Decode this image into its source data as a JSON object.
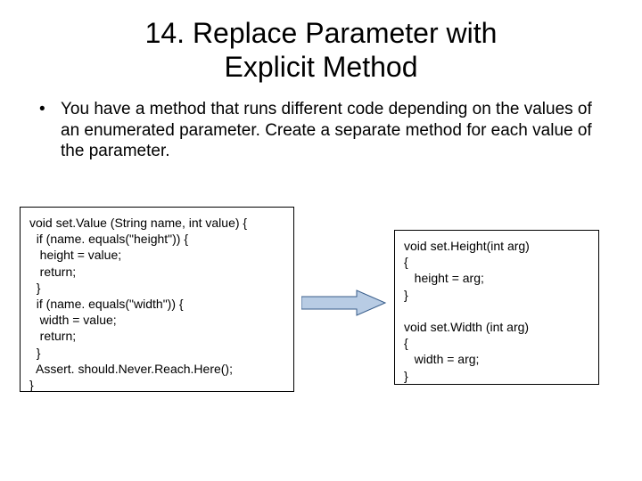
{
  "title": "14.  Replace Parameter with\nExplicit Method",
  "bullet": "You have a method that runs different code depending on the values of an enumerated parameter.  Create a separate method for each value of the parameter.",
  "code_before": "void set.Value (String name, int value) {\n  if (name. equals(\"height\")) {\n   height = value;\n   return;\n  }\n  if (name. equals(\"width\")) {\n   width = value;\n   return;\n  }\n  Assert. should.Never.Reach.Here();\n}",
  "code_after": "void set.Height(int arg)\n{\n   height = arg;\n}\n\nvoid set.Width (int arg)\n{\n   width = arg;\n}",
  "arrow": {
    "fill": "#b8cce4",
    "stroke": "#385d8a"
  }
}
